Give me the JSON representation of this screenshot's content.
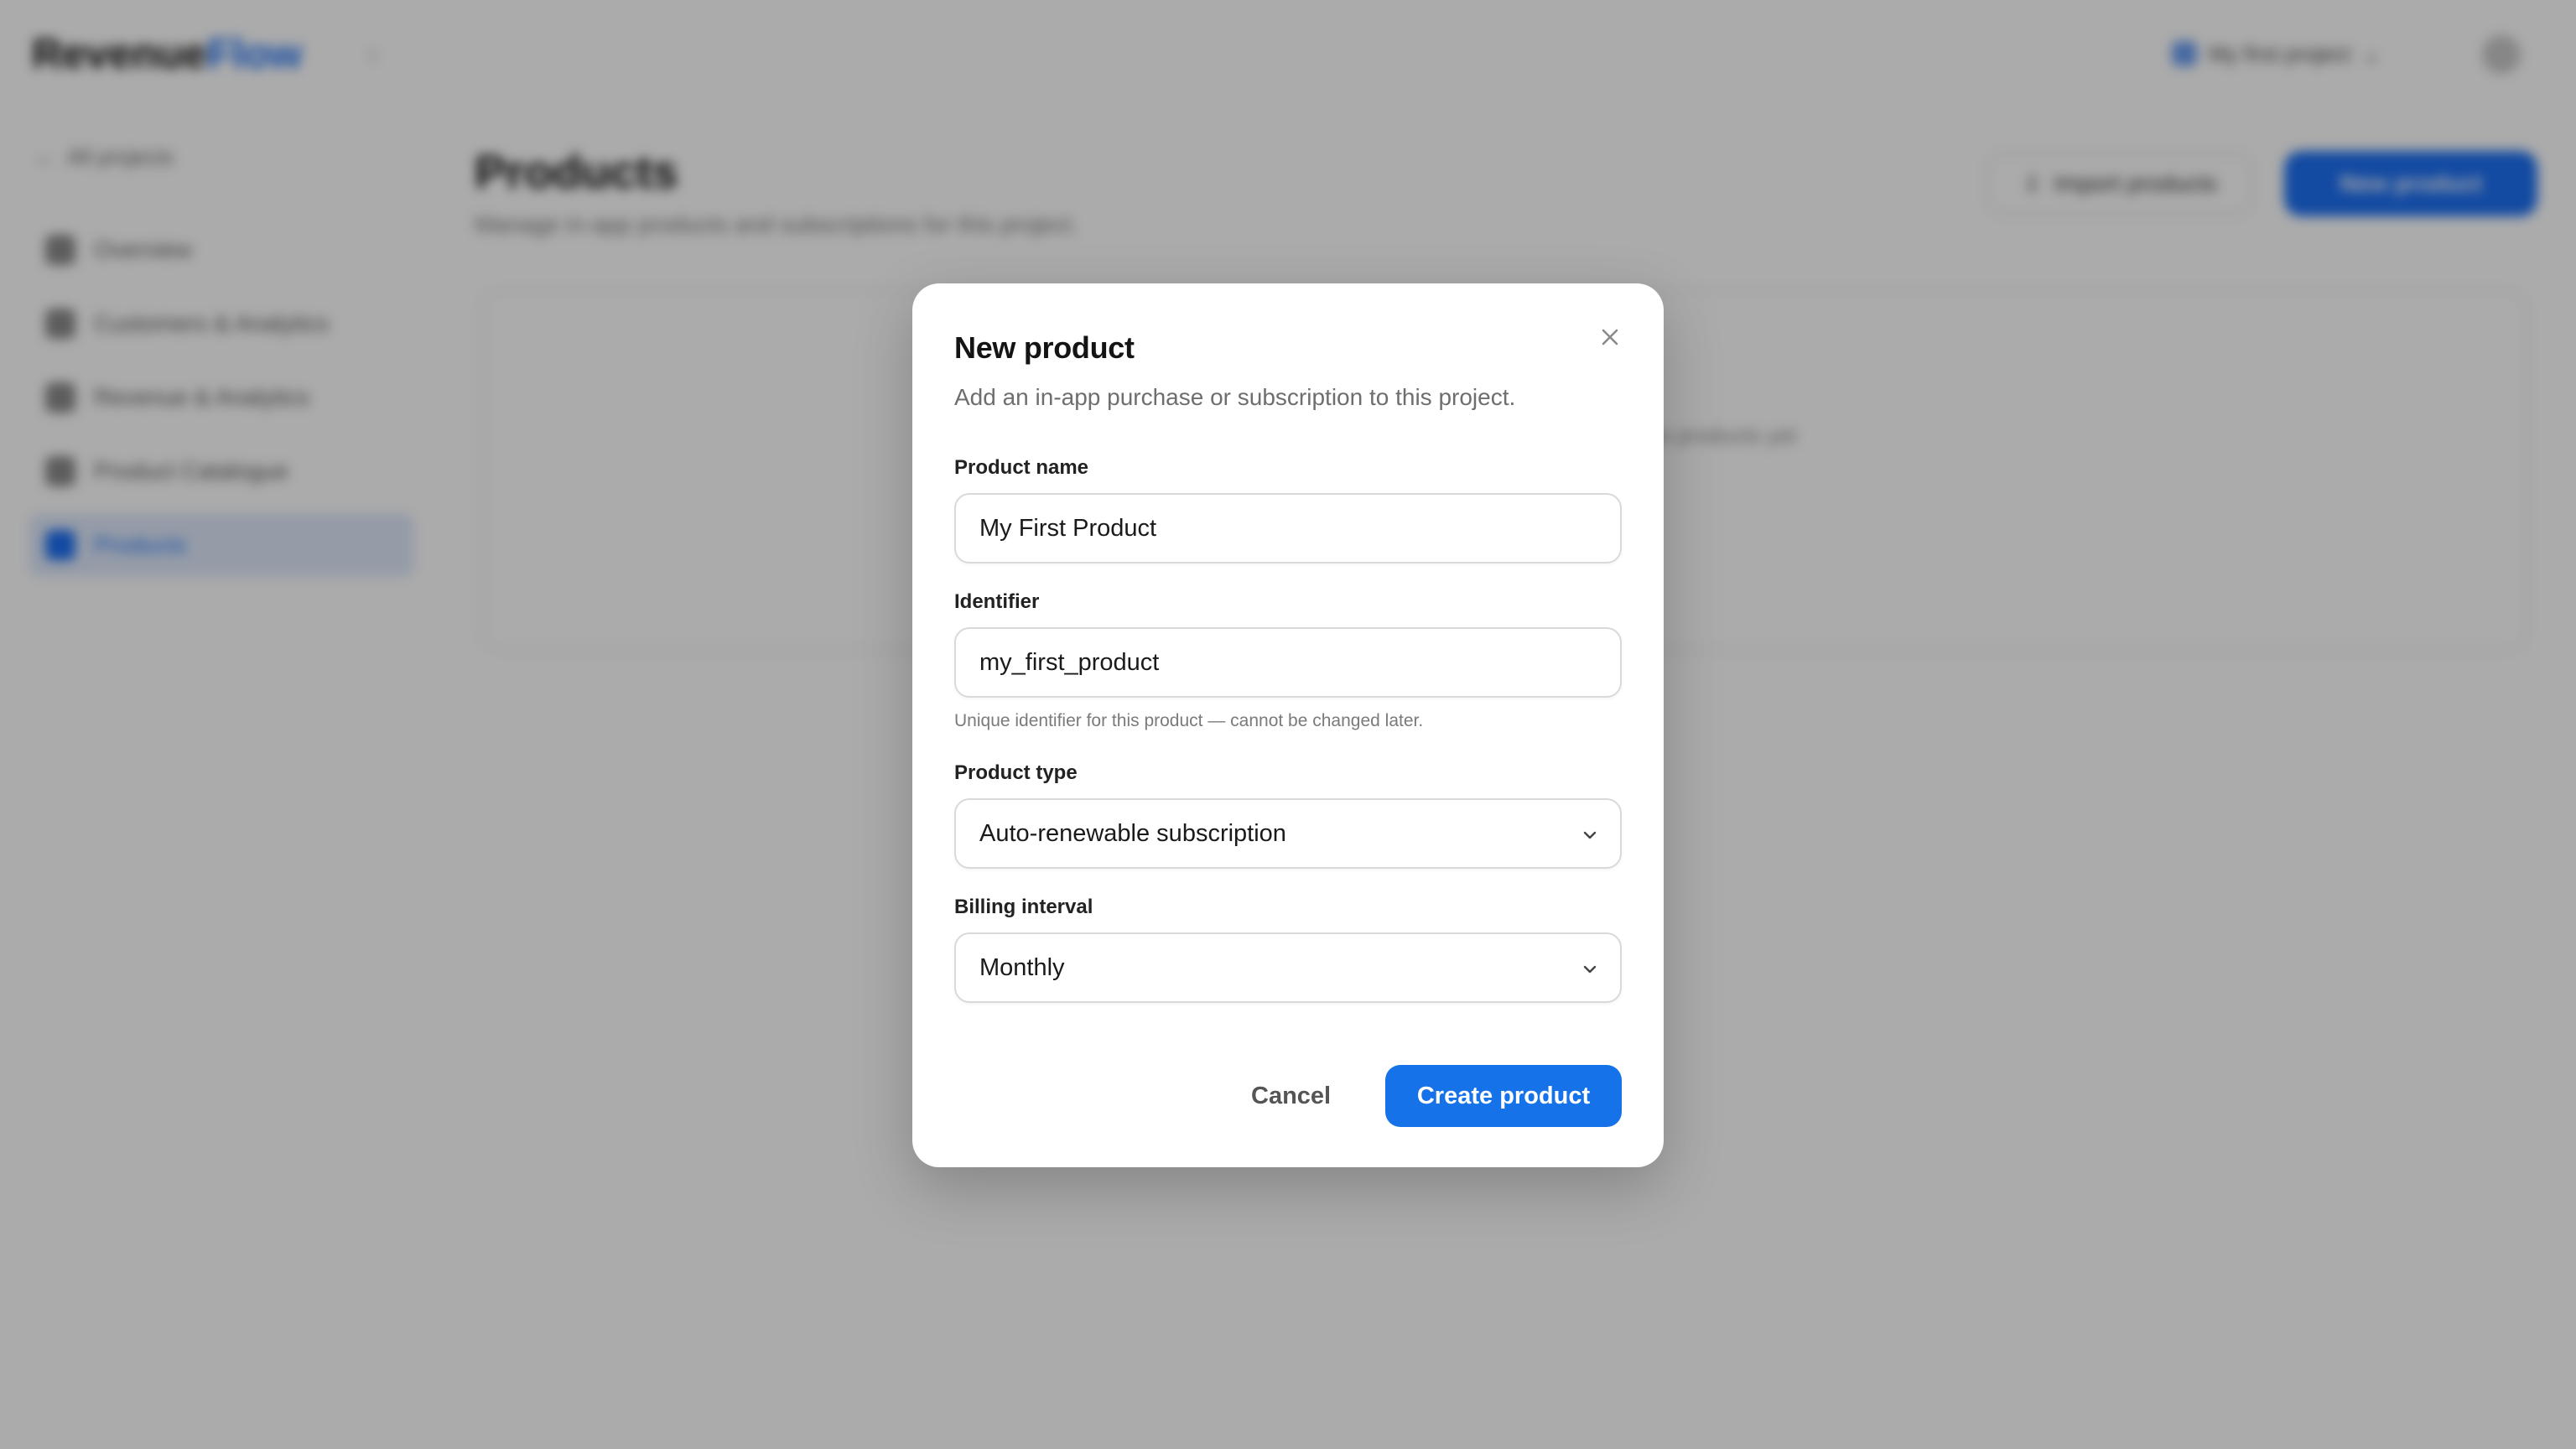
{
  "background": {
    "brand": {
      "name_a": "Revenue",
      "name_b": "Flow"
    },
    "project_switcher": {
      "label": "My first project"
    },
    "sidebar": {
      "back_label": "All projects",
      "items": [
        {
          "label": "Overview",
          "icon": "grid-icon"
        },
        {
          "label": "Customers & Analytics",
          "icon": "chart-icon"
        },
        {
          "label": "Revenue & Analytics",
          "icon": "dollar-icon"
        },
        {
          "label": "Product Catalogue",
          "icon": "box-icon"
        },
        {
          "label": "Products",
          "icon": "tag-icon",
          "active": true
        }
      ]
    },
    "page": {
      "title": "Products",
      "subtitle": "Manage in-app products and subscriptions for this project.",
      "import_label": "Import products",
      "new_label": "New product",
      "empty_text": "No products yet"
    }
  },
  "modal": {
    "title": "New product",
    "description": "Add an in-app purchase or subscription to this project.",
    "fields": {
      "product_name": {
        "label": "Product name",
        "value": "My First Product"
      },
      "identifier": {
        "label": "Identifier",
        "value": "my_first_product",
        "helper": "Unique identifier for this product — cannot be changed later."
      },
      "product_type": {
        "label": "Product type",
        "value": "Auto-renewable subscription"
      },
      "billing_interval": {
        "label": "Billing interval",
        "value": "Monthly"
      }
    },
    "cancel_label": "Cancel",
    "create_label": "Create product"
  },
  "colors": {
    "accent": "#1572e8",
    "overlay": "rgba(0,0,0,0.33)"
  }
}
